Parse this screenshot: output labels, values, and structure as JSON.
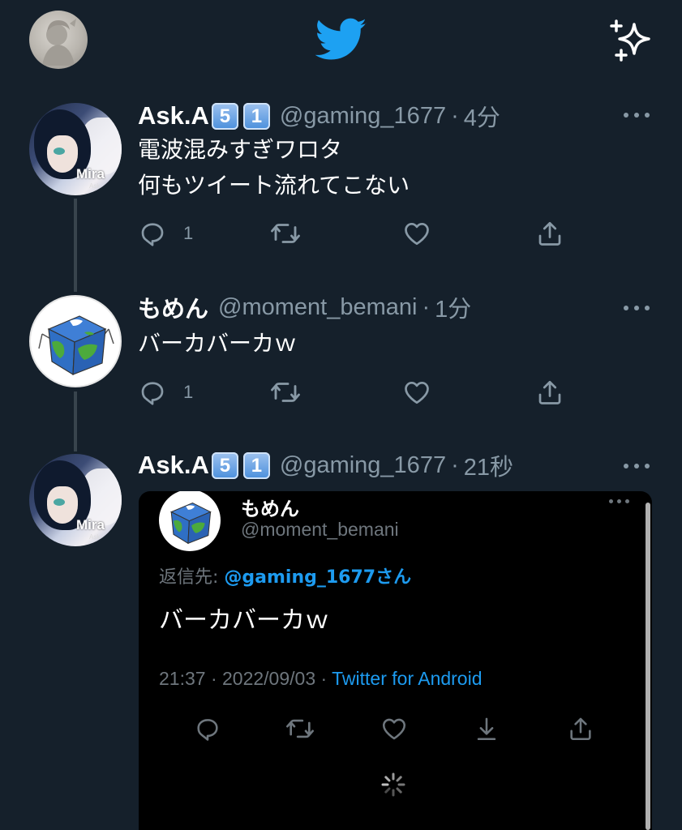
{
  "header": {
    "profile_avatar_icon": "profile-avatar",
    "logo_icon": "twitter-bird-icon",
    "timeline_icon": "sparkle-icon",
    "colors": {
      "background": "#15202b",
      "brand": "#1da1f2",
      "secondary_text": "#8899a6"
    }
  },
  "tweets": [
    {
      "display_name": "Ask.A",
      "keycaps": [
        "5",
        "1"
      ],
      "handle": "@gaming_1677",
      "separator": "·",
      "time": "4分",
      "lines": [
        "電波混みすぎワロタ",
        "何もツイート流れてこない"
      ],
      "reply_count": "1"
    },
    {
      "display_name": "もめん",
      "handle": "@moment_bemani",
      "separator": "·",
      "time": "1分",
      "lines": [
        "バーカバーカｗ"
      ],
      "reply_count": "1"
    },
    {
      "display_name": "Ask.A",
      "keycaps": [
        "5",
        "1"
      ],
      "handle": "@gaming_1677",
      "separator": "·",
      "time": "21秒",
      "embedded": {
        "display_name": "もめん",
        "handle": "@moment_bemani",
        "reply_prefix": "返信先: ",
        "reply_to": "@gaming_1677",
        "reply_suffix": "さん",
        "body": "バーカバーカｗ",
        "timestamp": "21:37 · 2022/09/03 · ",
        "source": "Twitter for Android"
      }
    }
  ]
}
